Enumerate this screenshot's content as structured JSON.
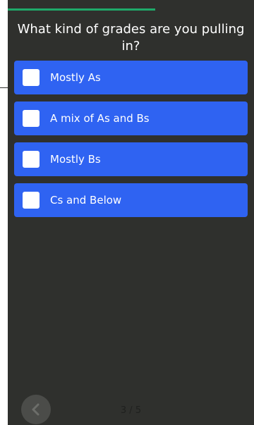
{
  "quiz": {
    "question": "What kind of grades are you pulling in?",
    "progress_fraction": 0.6,
    "page_counter": "3 / 5",
    "options": [
      {
        "label": "Mostly As"
      },
      {
        "label": "A mix of As and Bs"
      },
      {
        "label": "Mostly Bs"
      },
      {
        "label": "Cs and Below"
      }
    ],
    "back_icon": "chevron-left-icon"
  },
  "colors": {
    "background": "#2f302d",
    "option_blue": "#2f63f2",
    "progress_green": "#1faa6a",
    "back_button": "#4b4c49"
  }
}
